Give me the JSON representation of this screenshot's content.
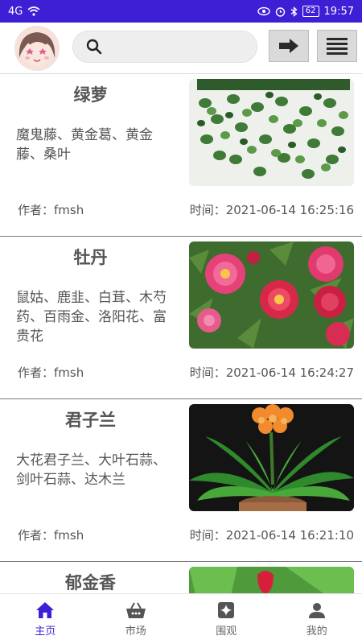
{
  "status_bar": {
    "signal": "4G",
    "battery": "62",
    "time": "19:57"
  },
  "header": {
    "search_placeholder": "",
    "go_label": "",
    "menu_label": ""
  },
  "items": [
    {
      "title": "绿萝",
      "aliases": "魔鬼藤、黄金葛、黄金藤、桑叶",
      "author": "作者：fmsh",
      "time": "时间：2021-06-14 16:25:16"
    },
    {
      "title": "牡丹",
      "aliases": "鼠姑、鹿韭、白茸、木芍药、百雨金、洛阳花、富贵花",
      "author": "作者：fmsh",
      "time": "时间：2021-06-14 16:24:27"
    },
    {
      "title": "君子兰",
      "aliases": "大花君子兰、大叶石蒜、剑叶石蒜、达木兰",
      "author": "作者：fmsh",
      "time": "时间：2021-06-14 16:21:10"
    },
    {
      "title": "郁金香",
      "aliases": "",
      "author": "",
      "time": ""
    }
  ],
  "bottom_nav": [
    {
      "label": "主页",
      "icon": "home-icon",
      "active": true
    },
    {
      "label": "市场",
      "icon": "basket-icon",
      "active": false
    },
    {
      "label": "围观",
      "icon": "sparkle-icon",
      "active": false
    },
    {
      "label": "我的",
      "icon": "person-icon",
      "active": false
    }
  ],
  "colors": {
    "accent": "#3e1fd6"
  }
}
